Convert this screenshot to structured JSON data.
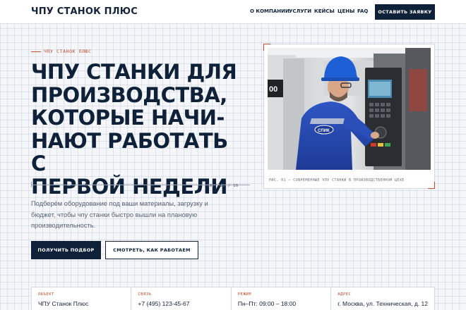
{
  "header": {
    "logo": "ЧПУ СТАНОК ПЛЮС",
    "nav": [
      "О КОМПАНИИ",
      "УСЛУГИ",
      "КЕЙСЫ",
      "ЦЕНЫ",
      "FAQ"
    ],
    "cta": "ОСТАВИТЬ ЗАЯВКУ"
  },
  "hero": {
    "eyebrow": "ЧПУ СТАНОК ПЛЮС",
    "title_lines": [
      "ЧПУ СТАНКИ ДЛЯ",
      "ПРОИЗВОДСТВА,",
      "КОТОРЫЕ НАЧИ-",
      "НАЮТ РАБОТАТЬ С",
      "ПЕРВОЙ НЕДЕЛИ"
    ],
    "sheet": "ЛИСТ 01 / 10",
    "lead": "Подберём оборудование под ваши материалы, загрузку и бюджет, чтобы чпу станки быстро вышли на плановую производительность.",
    "primary_button": "ПОЛУЧИТЬ ПОДБОР",
    "secondary_button": "СМОТРЕТЬ, КАК РАБОТАЕМ"
  },
  "photo": {
    "caption": "РИС. 01 — СОВРЕМЕННЫЕ ЧПУ СТАНКИ В ПРОИЗВОДСТВЕННОМ ЦЕХЕ",
    "badge_text": "СПИК"
  },
  "info": [
    {
      "label": "ОБЪЕКТ",
      "value": "ЧПУ Станок Плюс"
    },
    {
      "label": "СВЯЗЬ",
      "value": "+7 (495) 123-45-67"
    },
    {
      "label": "РЕЖИМ",
      "value": "Пн–Пт: 09:00 – 18:00"
    },
    {
      "label": "АДРЕС",
      "value": "г. Москва, ул. Техническая, д. 12"
    }
  ],
  "colors": {
    "navy": "#0f2138",
    "accent": "#c8492b",
    "background": "#f4f6f9"
  }
}
